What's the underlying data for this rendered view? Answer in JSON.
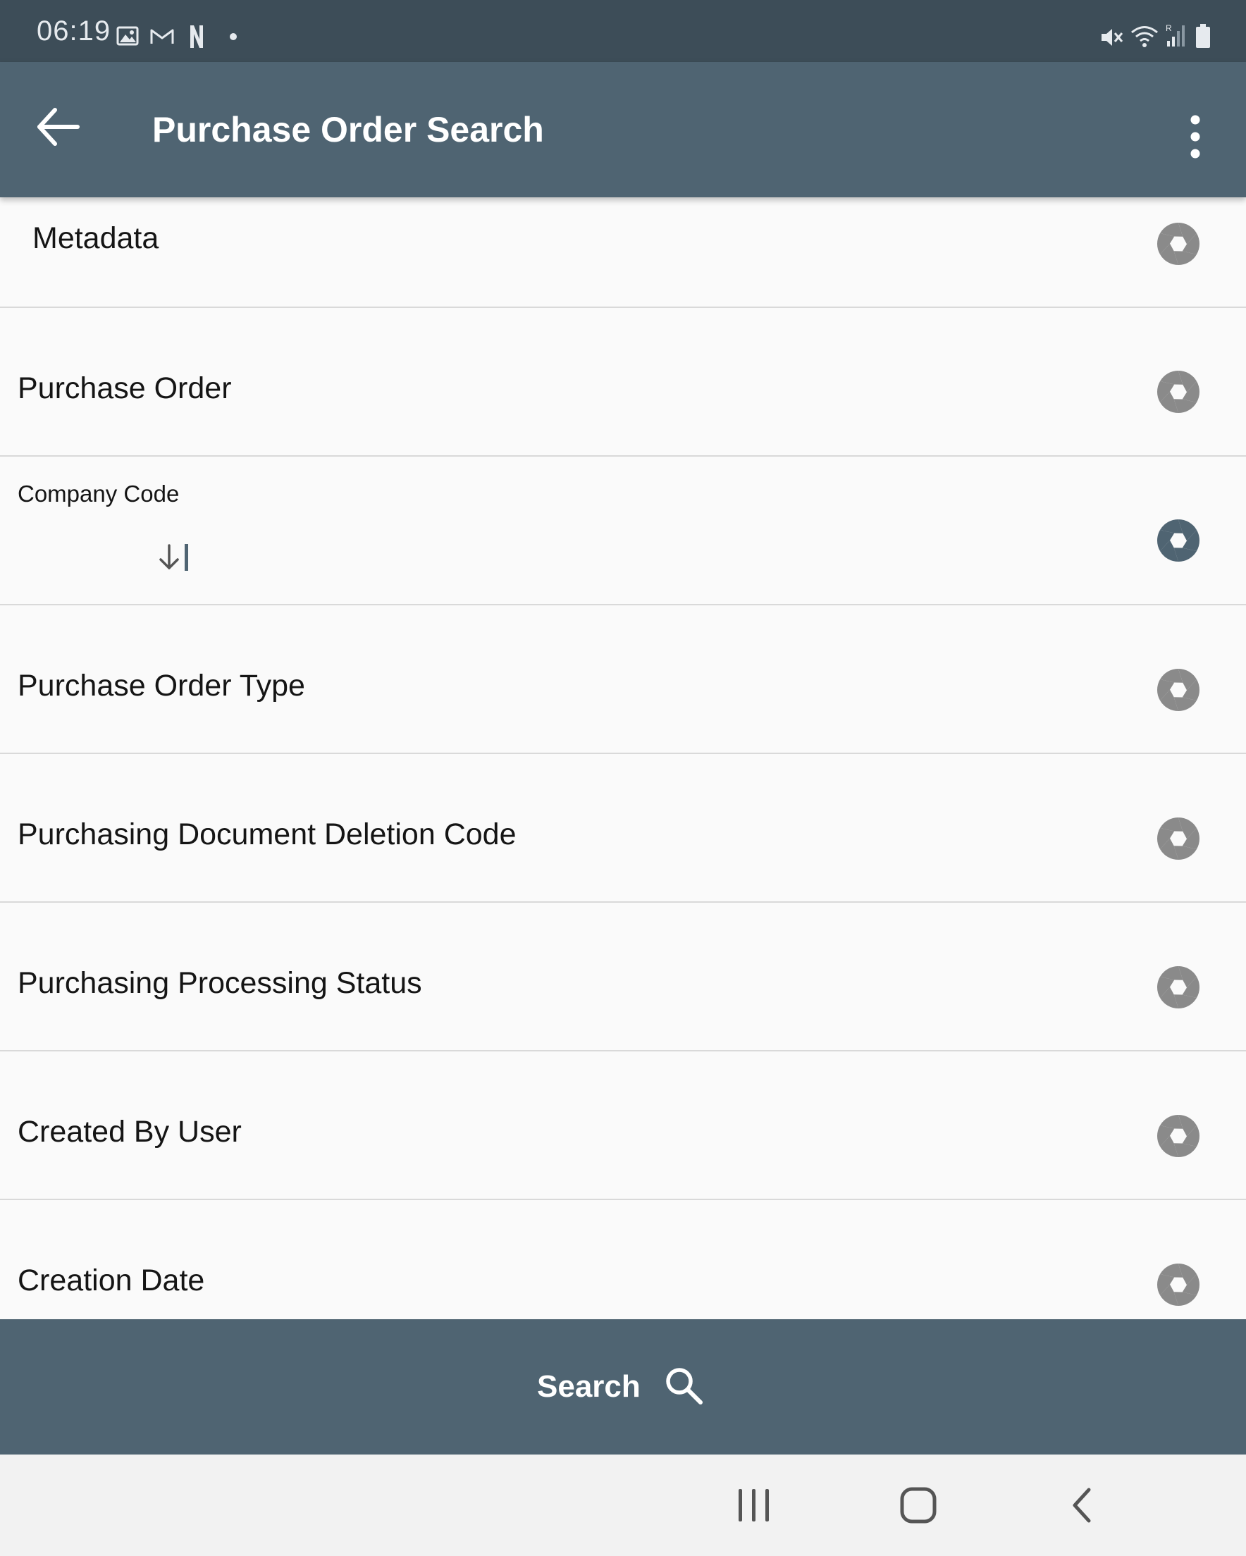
{
  "status_bar": {
    "time": "06:19"
  },
  "app_bar": {
    "title": "Purchase Order Search"
  },
  "fields": [
    {
      "label": "Metadata",
      "icon": "aperture-icon",
      "style": "large"
    },
    {
      "label": "Purchase Order",
      "icon": "aperture-icon",
      "style": "large"
    },
    {
      "label": "Company Code",
      "icon": "aperture-icon",
      "style": "small",
      "active": true,
      "value": ""
    },
    {
      "label": "Purchase Order Type",
      "icon": "aperture-icon",
      "style": "large"
    },
    {
      "label": "Purchasing Document Deletion Code",
      "icon": "aperture-icon",
      "style": "large"
    },
    {
      "label": "Purchasing Processing Status",
      "icon": "aperture-icon",
      "style": "large"
    },
    {
      "label": "Created By User",
      "icon": "aperture-icon",
      "style": "large"
    },
    {
      "label": "Creation Date",
      "icon": "aperture-icon",
      "style": "large"
    }
  ],
  "search_button": {
    "label": "Search",
    "icon": "search-icon"
  },
  "nav_bar": {
    "buttons": [
      "recents-icon",
      "home-icon",
      "back-icon"
    ]
  },
  "colors": {
    "status_bar": "#3d4d58",
    "app_bar": "#4f6472",
    "background": "#fafafa",
    "divider": "#d9d9d9",
    "icon_inactive": "#8a8a8a",
    "icon_active": "#4f6472"
  }
}
